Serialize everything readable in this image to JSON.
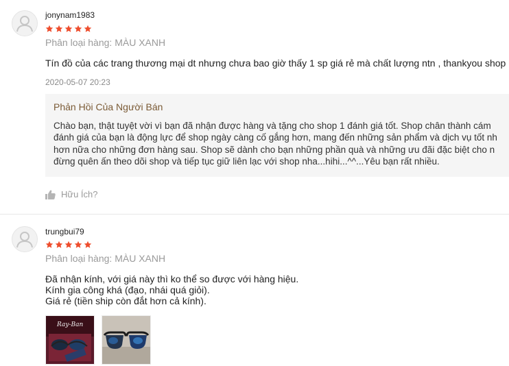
{
  "reviews": [
    {
      "username": "jonynam1983",
      "rating": 5,
      "variation": "Phân loại hàng: MÀU XANH",
      "content": [
        "Tín đồ của các trang thương mại dt nhưng chưa bao giờ thấy 1 sp giá rẻ mà chất lượng ntn , thankyou shop"
      ],
      "timestamp": "2020-05-07 20:23",
      "seller_reply": {
        "title": "Phản Hồi Của Người Bán",
        "lines": [
          "Chào bạn, thật tuyệt vời vì bạn đã nhận được hàng và tặng cho shop 1 đánh giá tốt. Shop chân thành cám",
          "đánh giá của bạn là động lực để shop ngày càng cố gắng hơn, mang đến những sản phẩm và dịch vụ tốt nh",
          "hơn nữa cho những đơn hàng sau. Shop sẽ dành cho bạn những phần quà và những ưu đãi đặc biệt cho n",
          "đừng quên ấn theo dõi shop và tiếp tục giữ liên lạc với shop nha...hihi...^^...Yêu bạn rất nhiều."
        ]
      },
      "helpful_label": "Hữu Ích?"
    },
    {
      "username": "trungbui79",
      "rating": 5,
      "variation": "Phân loại hàng: MÀU XANH",
      "content": [
        "Đã nhận kính, với giá này thì ko thể so được với hàng hiệu.",
        "Kính gia công khá (đạo, nhái quá giỏi).",
        "Giá rẻ (tiền ship còn đắt hơn cả kính)."
      ],
      "images": [
        {
          "alt": "sunglasses-box-photo",
          "brand_text": "Ray-Ban"
        },
        {
          "alt": "sunglasses-photo"
        }
      ]
    }
  ],
  "colors": {
    "star": "#ee4d2d",
    "reply_bg": "#f5f5f5",
    "reply_title": "#7a5a35",
    "muted": "#9a9a9a"
  },
  "icons": {
    "avatar": "user-silhouette-icon",
    "star": "star-icon",
    "helpful": "thumbs-up-icon"
  }
}
